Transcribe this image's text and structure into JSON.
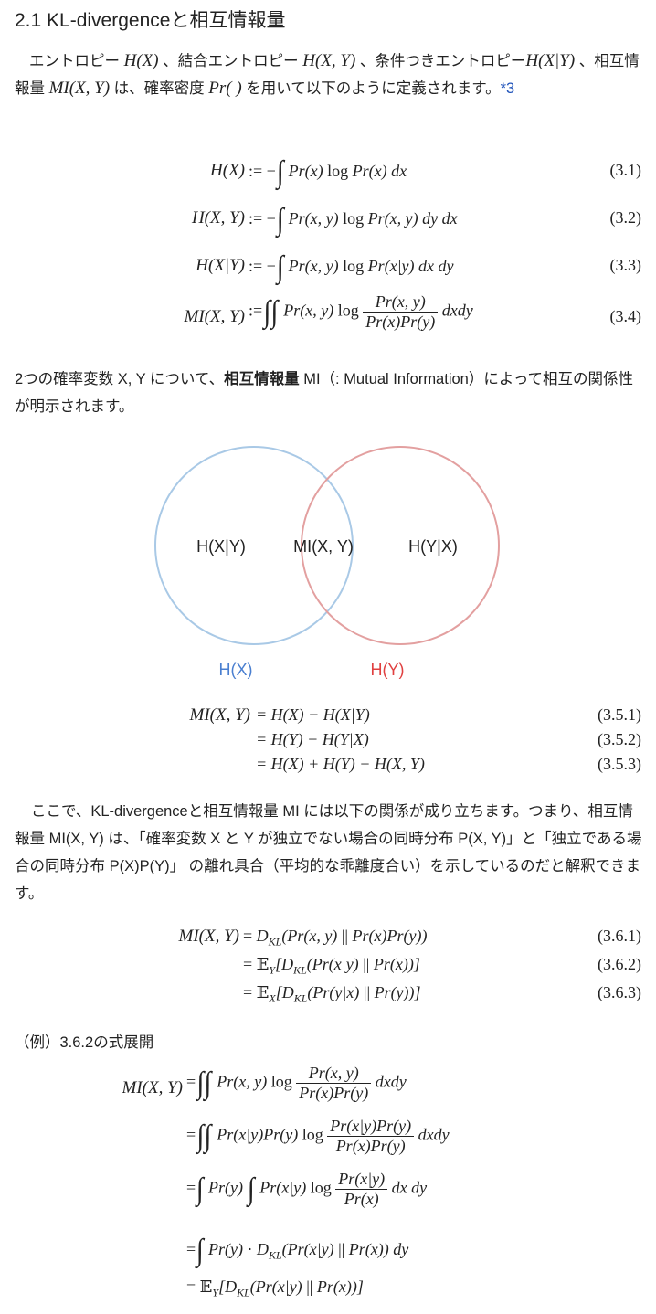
{
  "heading": "2.1 KL-divergenceと相互情報量",
  "intro": {
    "t1": "エントロピー ",
    "m1": "H(X)",
    "t2": " 、結合エントロピー ",
    "m2": "H(X, Y)",
    "t3": " 、条件つきエントロピー",
    "m3": "H(X|Y)",
    "t4": " 、相互情報量 ",
    "m4": "MI(X, Y)",
    "t5": " は、確率密度 ",
    "m5": "Pr( )",
    "t6": " を用いて以下のように定義されます。",
    "footnote": "*3"
  },
  "defs": [
    {
      "lhs": "H(X)",
      "num": "(3.1)"
    },
    {
      "lhs": "H(X, Y)",
      "num": "(3.2)"
    },
    {
      "lhs": "H(X|Y)",
      "num": "(3.3)"
    },
    {
      "lhs": "MI(X, Y)",
      "num": "(3.4)"
    }
  ],
  "para2": {
    "t1": "2つの確率変数 X, Y について、",
    "bold": "相互情報量",
    "t2": " MI（: Mutual Information）によって相互の関係性が明示されます。"
  },
  "venn": {
    "left_label": "H(X|Y)",
    "mid_label": "MI(X, Y)",
    "right_label": "H(Y|X)",
    "x_caption": "H(X)",
    "y_caption": "H(Y)",
    "color_x": "#a9c9e6",
    "color_y": "#e3a0a0",
    "caption_x_color": "#4a7fd0",
    "caption_y_color": "#e04040"
  },
  "mi_eqs": [
    {
      "lhs": "MI(X, Y)",
      "rhs": "= H(X) − H(X|Y)",
      "num": "(3.5.1)"
    },
    {
      "lhs": "",
      "rhs": "= H(Y) − H(Y|X)",
      "num": "(3.5.2)"
    },
    {
      "lhs": "",
      "rhs": "= H(X) + H(Y) − H(X, Y)",
      "num": "(3.5.3)"
    }
  ],
  "para3": "ここで、KL-divergenceと相互情報量 MI には以下の関係が成り立ちます。つまり、相互情報量 MI(X, Y) は、「確率変数 X と Y が独立でない場合の同時分布 P(X, Y)」と「独立である場合の同時分布 P(X)P(Y)」 の離れ具合（平均的な乖離度合い）を示しているのだと解釈できます。",
  "kl_eqs": [
    {
      "lhs": "MI(X, Y)",
      "num": "(3.6.1)"
    },
    {
      "lhs": "",
      "num": "(3.6.2)"
    },
    {
      "lhs": "",
      "num": "(3.6.3)"
    }
  ],
  "example_label": "（例）3.6.2の式展開",
  "example_lhs": "MI(X, Y)"
}
